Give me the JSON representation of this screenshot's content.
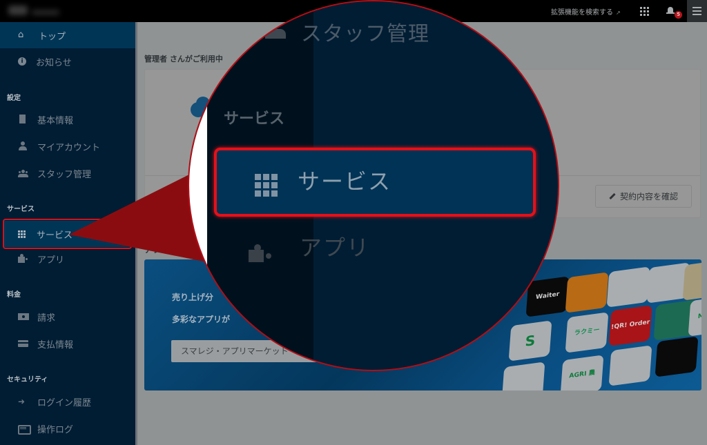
{
  "topbar": {
    "extension_search_label": "拡張機能を検索する",
    "notification_count": "5"
  },
  "sidebar": {
    "items_top": [
      {
        "label": "トップ",
        "icon": "home-icon",
        "active": true
      },
      {
        "label": "お知らせ",
        "icon": "info-icon",
        "active": false
      }
    ],
    "sections": [
      {
        "title": "設定",
        "items": [
          {
            "label": "基本情報",
            "icon": "building-icon"
          },
          {
            "label": "マイアカウント",
            "icon": "user-icon"
          },
          {
            "label": "スタッフ管理",
            "icon": "users-icon"
          }
        ]
      },
      {
        "title": "サービス",
        "items": [
          {
            "label": "サービス",
            "icon": "grid-icon",
            "highlighted": true
          },
          {
            "label": "アプリ",
            "icon": "puzzle-icon"
          }
        ]
      },
      {
        "title": "料金",
        "items": [
          {
            "label": "請求",
            "icon": "money-icon"
          },
          {
            "label": "支払情報",
            "icon": "credit-card-icon"
          }
        ]
      },
      {
        "title": "セキュリティ",
        "items": [
          {
            "label": "ログイン履歴",
            "icon": "sign-in-icon"
          },
          {
            "label": "操作ログ",
            "icon": "keyboard-icon"
          }
        ]
      }
    ]
  },
  "main": {
    "usage_heading": "管理者 さんがご利用中",
    "contract_button": "契約内容を確認",
    "apps_heading": "アプリマーケット",
    "banner": {
      "line1": "売り上げ分",
      "line2": "多彩なアプリが",
      "market_button": "スマレジ・アプリマーケット",
      "tiles": [
        "Waiter",
        "",
        "",
        "",
        "",
        "",
        "ラクミー",
        "!QR! Order",
        "",
        "Mr. Mo",
        "",
        "AGRI 農",
        ""
      ]
    }
  },
  "magnifier": {
    "staff_label": "スタッフ管理",
    "section_label": "サービス",
    "highlighted_item": "サービス",
    "next_item": "アプリ"
  },
  "colors": {
    "highlight": "#e51019",
    "sidebar_bg": "#001d33",
    "active_bg": "#003556"
  }
}
